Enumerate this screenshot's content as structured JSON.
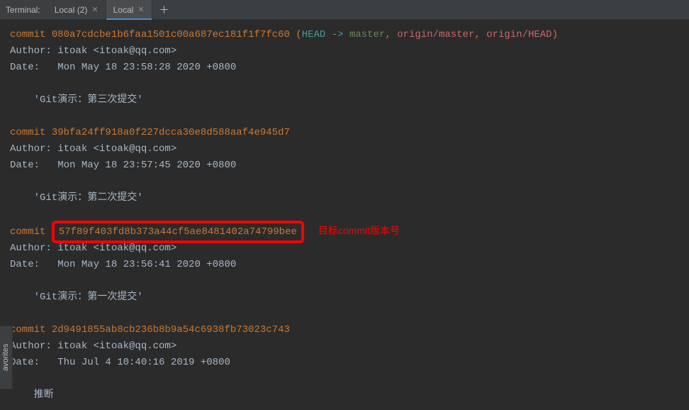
{
  "tabbar": {
    "label": "Terminal:",
    "tabs": [
      {
        "name": "Local (2)",
        "active": false
      },
      {
        "name": "Local",
        "active": true
      }
    ]
  },
  "sidebar": {
    "favorites": "avorites"
  },
  "log": {
    "commits": [
      {
        "hash": "080a7cdcbe1b6faa1501c00a687ec181f1f7fc60",
        "head_label": "HEAD -> ",
        "head_branch": "master",
        "remote1": "origin/master",
        "remote2": "origin/HEAD",
        "author": "Author: itoak <itoak@qq.com>",
        "date": "Date:   Mon May 18 23:58:28 2020 +0800",
        "msg": "    'Git演示：第三次提交'"
      },
      {
        "hash": "39bfa24ff918a0f227dcca30e8d588aaf4e945d7",
        "author": "Author: itoak <itoak@qq.com>",
        "date": "Date:   Mon May 18 23:57:45 2020 +0800",
        "msg": "    'Git演示：第二次提交'"
      },
      {
        "hash": "57f89f403fd8b373a44cf5ae8481402a74799bee",
        "author": "Author: itoak <itoak@qq.com>",
        "date": "Date:   Mon May 18 23:56:41 2020 +0800",
        "msg": "    'Git演示：第一次提交'",
        "highlight": true,
        "annotation": "目标commit版本号"
      },
      {
        "hash": "2d9491855ab8cb236b8b9a54c6938fb73023c743",
        "author": "Author: itoak <itoak@qq.com>",
        "date": "Date:   Thu Jul 4 10:40:16 2019 +0800",
        "msg": "    推断"
      }
    ],
    "commit_word": "commit "
  }
}
